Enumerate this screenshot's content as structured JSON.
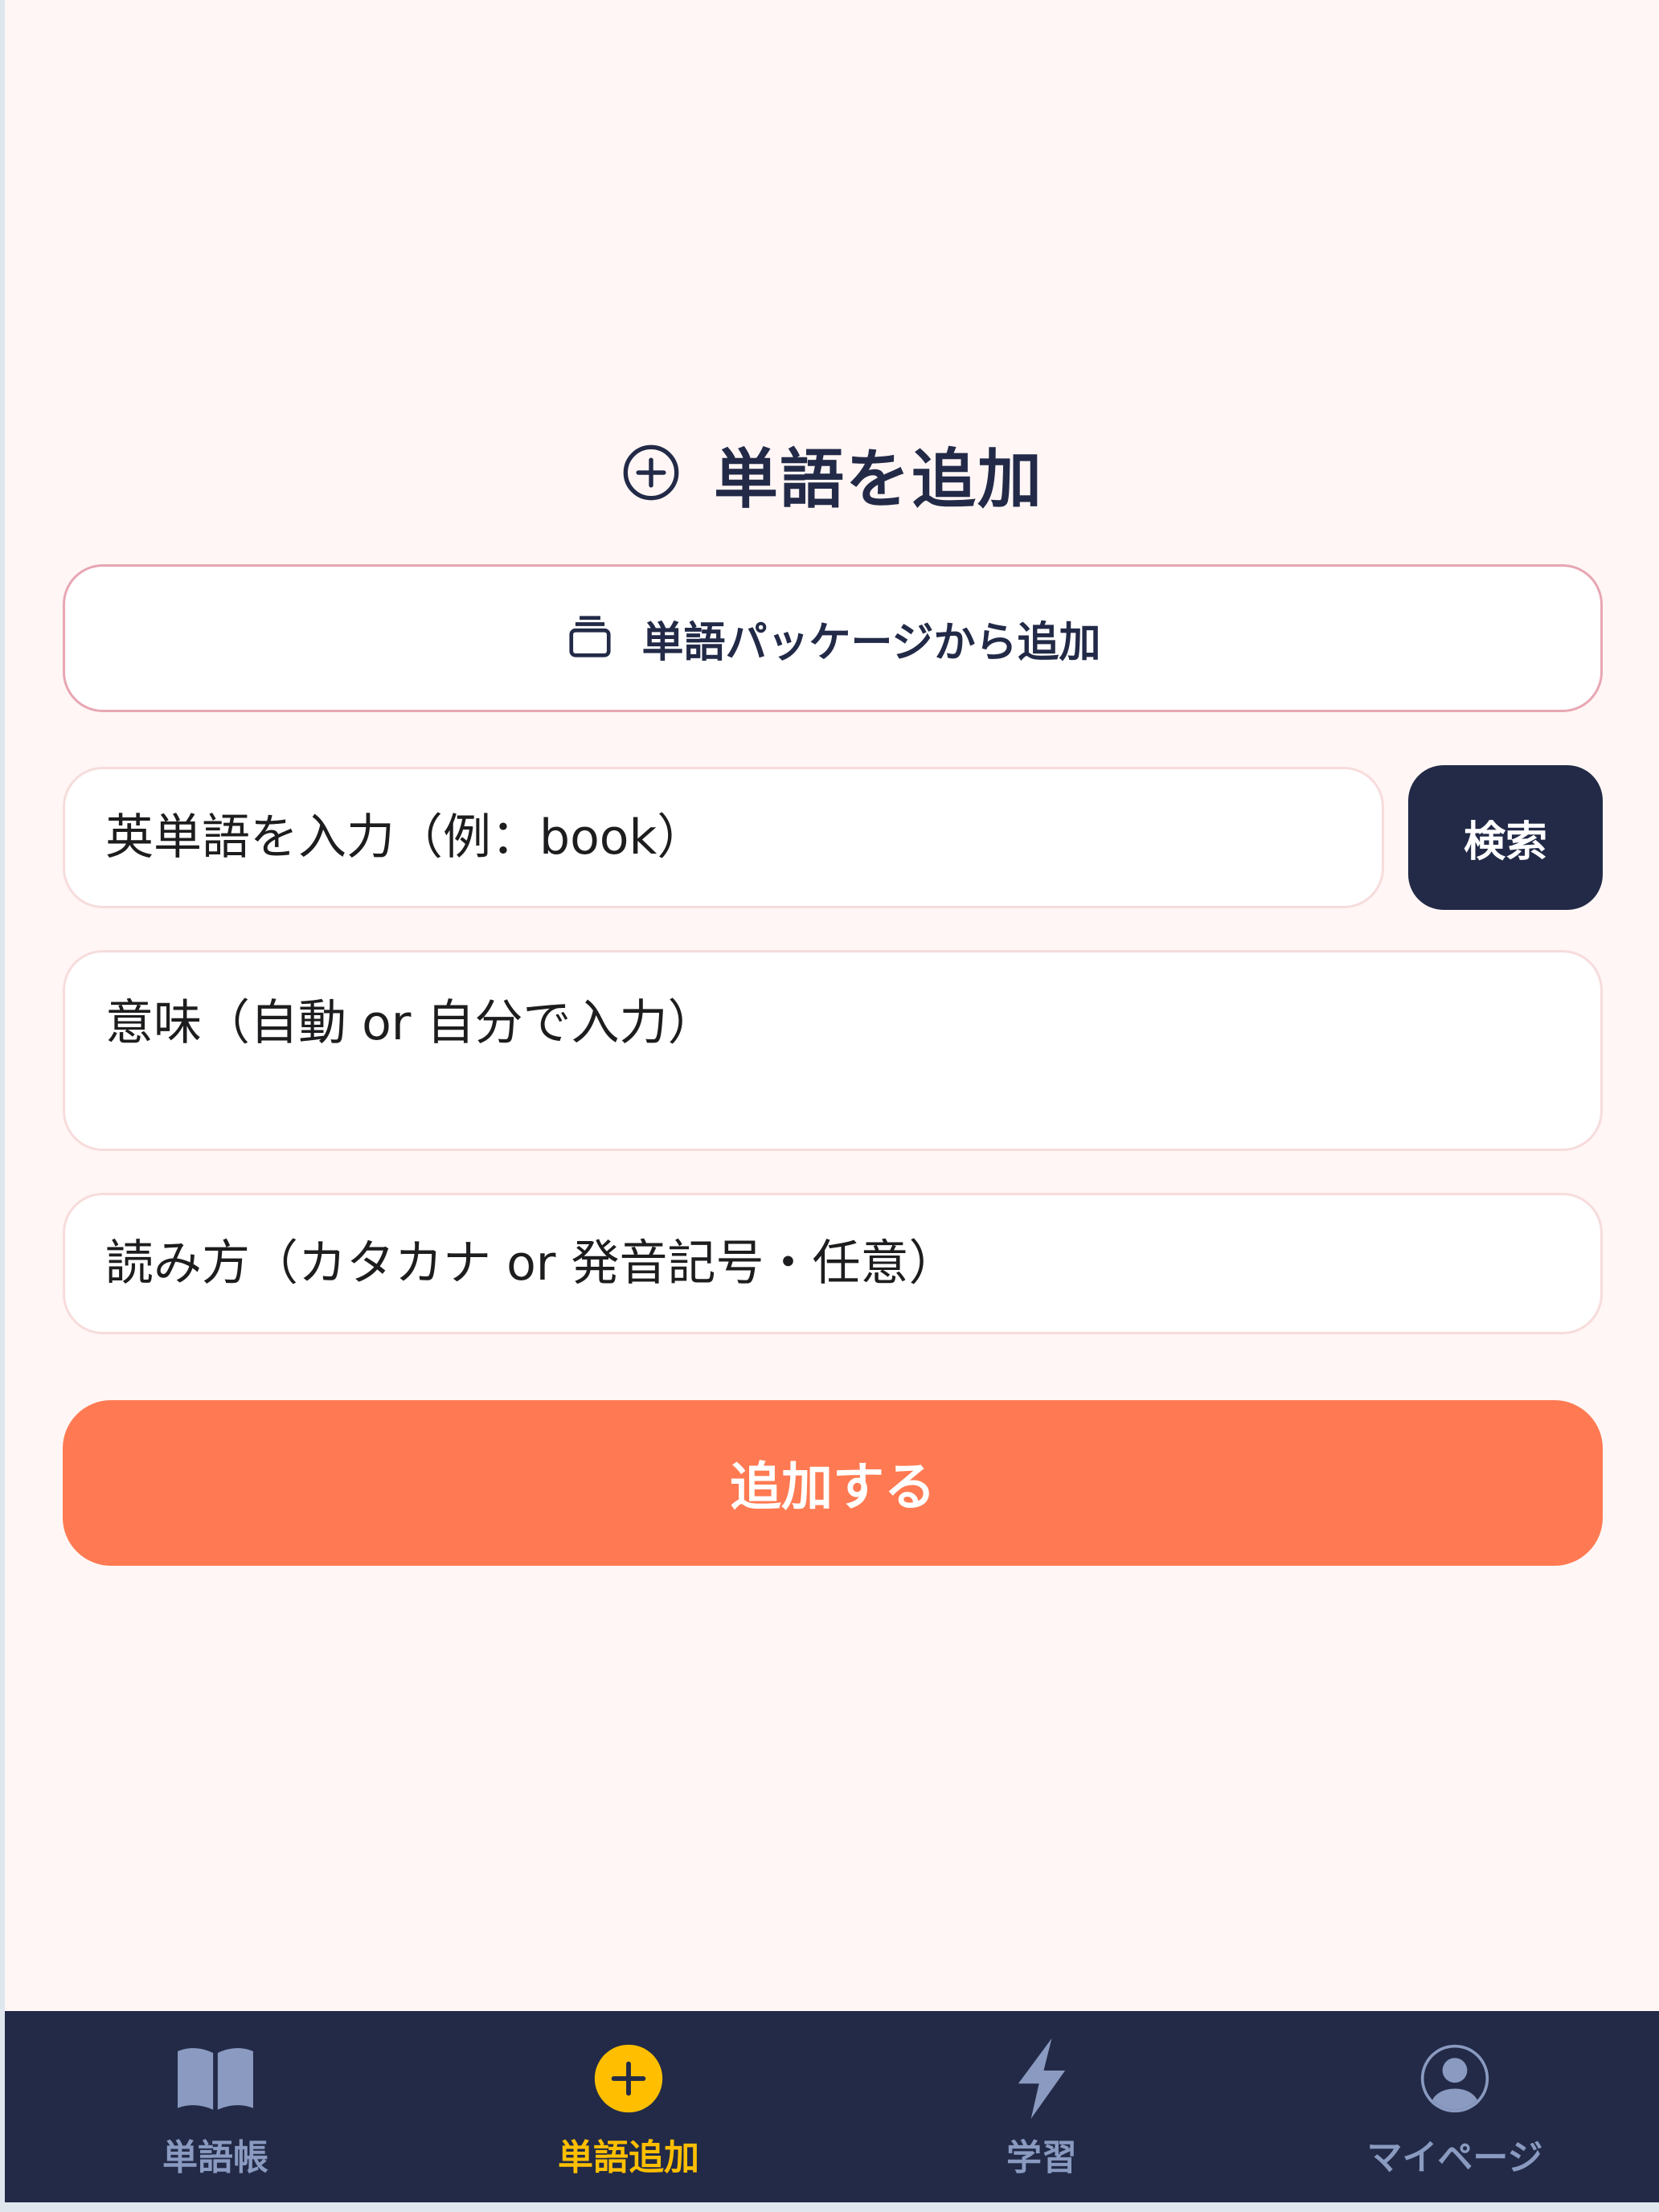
{
  "page": {
    "title": "単語を追加"
  },
  "package_button": {
    "label": "単語パッケージから追加"
  },
  "form": {
    "word_placeholder": "英単語を入力（例：book）",
    "word_value": "",
    "search_label": "検索",
    "meaning_placeholder": "意味（自動 or 自分で入力）",
    "meaning_value": "",
    "reading_placeholder": "読み方（カタカナ or 発音記号・任意）",
    "reading_value": "",
    "submit_label": "追加する"
  },
  "nav": {
    "items": [
      {
        "label": "単語帳",
        "icon": "book-icon",
        "active": false
      },
      {
        "label": "単語追加",
        "icon": "plus-circle-icon",
        "active": true
      },
      {
        "label": "学習",
        "icon": "lightning-icon",
        "active": false
      },
      {
        "label": "マイページ",
        "icon": "user-circle-icon",
        "active": false
      }
    ]
  },
  "colors": {
    "background": "#fff6f5",
    "navy": "#222a47",
    "accent_orange": "#ff7a52",
    "active_yellow": "#ffbf00",
    "inactive_nav": "#8a9ac0",
    "package_border": "#e8a6b3"
  }
}
